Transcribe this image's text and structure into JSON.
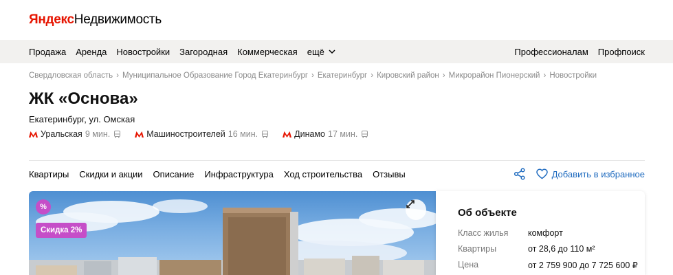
{
  "header": {
    "logo_brand": "Яндекс",
    "logo_product": "Недвижимость"
  },
  "nav": {
    "left_items": [
      "Продажа",
      "Аренда",
      "Новостройки",
      "Загородная",
      "Коммерческая"
    ],
    "more_label": "ещё",
    "right_items": [
      "Профессионалам",
      "Профпоиск"
    ]
  },
  "breadcrumbs": [
    "Свердловская область",
    "Муниципальное Образование Город Екатеринбург",
    "Екатеринбург",
    "Кировский район",
    "Микрорайон Пионерский",
    "Новостройки"
  ],
  "breadcrumb_separator": "›",
  "title": "ЖК «Основа»",
  "address": "Екатеринбург, ул. Омская",
  "metro": [
    {
      "name": "Уральская",
      "time": "9 мин."
    },
    {
      "name": "Машиностроителей",
      "time": "16 мин."
    },
    {
      "name": "Динамо",
      "time": "17 мин."
    }
  ],
  "tabs": [
    "Квартиры",
    "Скидки и акции",
    "Описание",
    "Инфраструктура",
    "Ход строительства",
    "Отзывы"
  ],
  "actions": {
    "favorite_label": "Добавить в избранное"
  },
  "photo": {
    "percent_badge": "%",
    "discount_badge": "Скидка 2%"
  },
  "about": {
    "title": "Об объекте",
    "rows": [
      {
        "key": "Класс жилья",
        "value": "комфорт"
      },
      {
        "key": "Квартиры",
        "value": "от 28,6 до 110 м²"
      },
      {
        "key": "Цена",
        "value": "от 2 759 900 до 7 725 600 ₽"
      }
    ]
  },
  "colors": {
    "brand_red": "#e61400",
    "link_blue": "#1f6bbf",
    "badge_purple": "#c54ec8",
    "nav_bg": "#f2f1ef"
  }
}
